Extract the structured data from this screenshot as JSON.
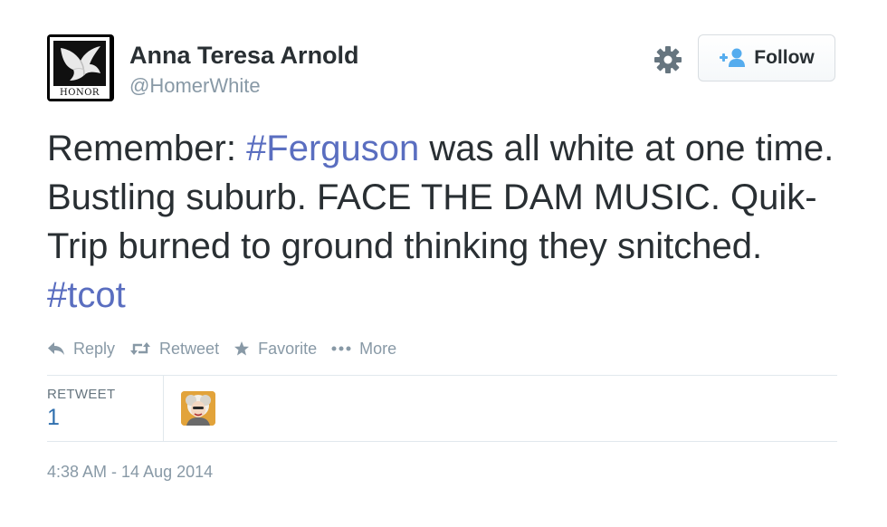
{
  "author": {
    "fullname": "Anna Teresa Arnold",
    "username": "@HomerWhite",
    "avatar_icon": "dove-icon",
    "avatar_caption": "HONOR"
  },
  "header": {
    "settings_icon": "gear-icon",
    "follow_label": "Follow",
    "follow_icon": "add-user-icon"
  },
  "tweet": {
    "segments": [
      {
        "text": "Remember: ",
        "type": "text"
      },
      {
        "text": "#Ferguson",
        "type": "hashtag"
      },
      {
        "text": " was all white at one time. Bustling suburb. FACE THE DAM MUSIC. Quik-Trip burned to ground thinking they snitched. ",
        "type": "text"
      },
      {
        "text": "#tcot",
        "type": "hashtag"
      }
    ]
  },
  "actions": {
    "reply": "Reply",
    "retweet": "Retweet",
    "favorite": "Favorite",
    "more": "More"
  },
  "stats": {
    "retweet_label": "RETWEET",
    "retweet_count": "1"
  },
  "timestamp": "4:38 AM - 14 Aug 2014",
  "colors": {
    "text": "#292f33",
    "muted": "#8899a6",
    "hashtag": "#5a6ec0",
    "follow_icon": "#55acee",
    "divider": "#e1e8ed"
  }
}
